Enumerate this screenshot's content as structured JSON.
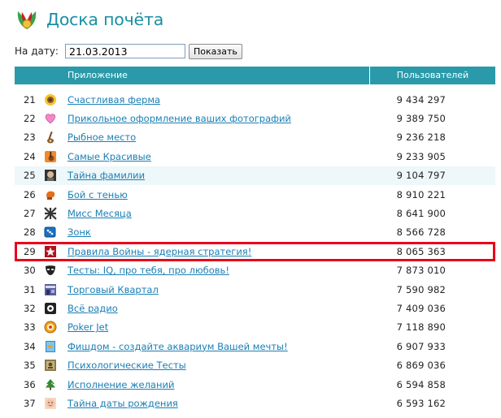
{
  "header": {
    "title": "Доска почёта"
  },
  "date_filter": {
    "label": "На дату:",
    "value": "21.03.2013",
    "button_label": "Показать"
  },
  "table": {
    "columns": {
      "app": "Приложение",
      "users": "Пользователей"
    },
    "highlighted_rank": "29",
    "rows": [
      {
        "rank": "21",
        "icon": "sunflower-icon",
        "name": "Счастливая ферма",
        "users": "9 434 297"
      },
      {
        "rank": "22",
        "icon": "heart-icon",
        "name": "Прикольное оформление ваших фотографий",
        "users": "9 389 750"
      },
      {
        "rank": "23",
        "icon": "fishing-rod-icon",
        "name": "Рыбное место",
        "users": "9 236 218"
      },
      {
        "rank": "24",
        "icon": "guitar-icon",
        "name": "Самые Красивые",
        "users": "9 233 905"
      },
      {
        "rank": "25",
        "icon": "face-icon",
        "name": "Тайна фамилии",
        "users": "9 104 797"
      },
      {
        "rank": "26",
        "icon": "boxing-glove-icon",
        "name": "Бой с тенью",
        "users": "8 910 221"
      },
      {
        "rank": "27",
        "icon": "grid-pattern-icon",
        "name": "Мисс Месяца",
        "users": "8 641 900"
      },
      {
        "rank": "28",
        "icon": "dice-icon",
        "name": "Зонк",
        "users": "8 566 728"
      },
      {
        "rank": "29",
        "icon": "red-star-icon",
        "name": "Правила Войны - ядерная стратегия!",
        "users": "8 065 363"
      },
      {
        "rank": "30",
        "icon": "mask-icon",
        "name": "Тесты: IQ, про тебя, про любовь!",
        "users": "7 873 010"
      },
      {
        "rank": "31",
        "icon": "storefront-icon",
        "name": "Торговый Квартал",
        "users": "7 590 982"
      },
      {
        "rank": "32",
        "icon": "radio-icon",
        "name": "Всё радио",
        "users": "7 409 036"
      },
      {
        "rank": "33",
        "icon": "poker-chip-icon",
        "name": "Poker Jet",
        "users": "7 118 890"
      },
      {
        "rank": "34",
        "icon": "aquarium-icon",
        "name": "Фишдом - создайте аквариум Вашей мечты!",
        "users": "6 907 933"
      },
      {
        "rank": "35",
        "icon": "psychology-icon",
        "name": "Психологические Тесты",
        "users": "6 869 036"
      },
      {
        "rank": "36",
        "icon": "christmas-tree-icon",
        "name": "Исполнение желаний",
        "users": "6 594 858"
      },
      {
        "rank": "37",
        "icon": "baby-face-icon",
        "name": "Тайна даты рождения",
        "users": "6 593 162"
      }
    ]
  },
  "colors": {
    "accent": "#2a9aaa",
    "link": "#1a7fb5",
    "highlight": "#e8001b",
    "title": "#1a8fa3"
  }
}
